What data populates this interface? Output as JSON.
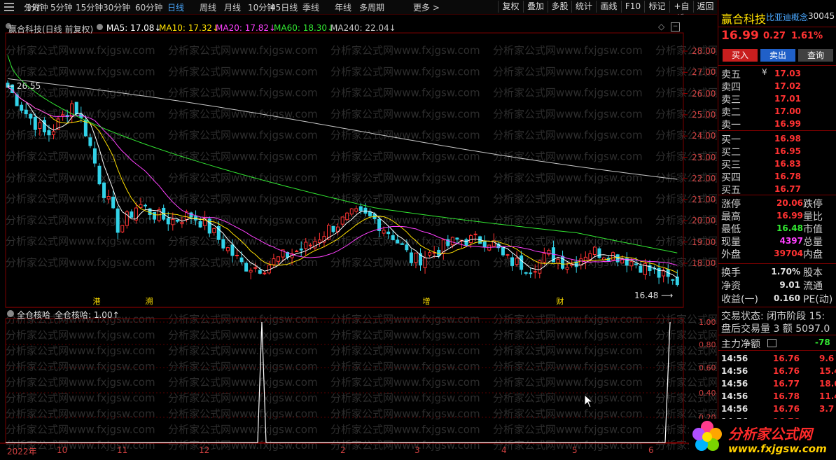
{
  "toolbar": {
    "periods": [
      "分时",
      "1分钟",
      "5分钟",
      "15分钟",
      "30分钟",
      "60分钟",
      "日线",
      "周线",
      "月线",
      "10分钟",
      "45日线",
      "季线",
      "年线",
      "多周期",
      "更多 >"
    ],
    "active_period": "日线",
    "buttons": [
      "复权",
      "叠加",
      "多股",
      "统计",
      "画线",
      "F10",
      "标记",
      "+自选",
      "返回"
    ]
  },
  "chart": {
    "stock_label": "赢合科技(日线 前复权)",
    "ma": [
      {
        "label": "MA5: 17.08↓",
        "color": "#ffffff"
      },
      {
        "label": "MA10: 17.32↓",
        "color": "#ffe000"
      },
      {
        "label": "MA20: 17.82↓",
        "color": "#ff40ff"
      },
      {
        "label": "MA60: 18.30↓",
        "color": "#32e832"
      },
      {
        "label": "MA240: 22.04↓",
        "color": "#c8c8c8"
      }
    ],
    "y_axis": [
      "28.00",
      "27.00",
      "26.00",
      "25.00",
      "24.00",
      "23.00",
      "22.00",
      "21.00",
      "20.00",
      "19.00",
      "18.00"
    ],
    "high_marker": "26.55",
    "low_marker": "16.48",
    "events": [
      "港",
      "溯",
      "增",
      "财"
    ],
    "watermark": "分析家公式网www.fxjgsw.com"
  },
  "indicator": {
    "name": "全仓核哈",
    "value_label": "全仓核哈: 1.00↑",
    "y_axis": [
      "1.00",
      "0.80",
      "0.60",
      "0.40",
      "0.20"
    ]
  },
  "x_axis": [
    "2022年",
    "10",
    "11",
    "12",
    "2",
    "3",
    "4",
    "5",
    "6"
  ],
  "quote": {
    "name": "赢合科技",
    "concept": "比亚迪概念",
    "code": "30045",
    "price": "16.99",
    "change": "0.27",
    "pct": "1.61%",
    "buy_btn": "买入",
    "sell_btn": "卖出",
    "query_btn": "查询",
    "asks": [
      {
        "label": "卖五",
        "price": "17.03"
      },
      {
        "label": "卖四",
        "price": "17.02"
      },
      {
        "label": "卖三",
        "price": "17.01"
      },
      {
        "label": "卖二",
        "price": "17.00"
      },
      {
        "label": "卖一",
        "price": "16.99"
      }
    ],
    "bids": [
      {
        "label": "买一",
        "price": "16.98"
      },
      {
        "label": "买二",
        "price": "16.95"
      },
      {
        "label": "买三",
        "price": "16.83"
      },
      {
        "label": "买四",
        "price": "16.78"
      },
      {
        "label": "买五",
        "price": "16.77"
      }
    ],
    "currency_mark": "¥",
    "stats": [
      {
        "l1": "涨停",
        "v1": "20.06",
        "c1": "red",
        "l2": "跌停"
      },
      {
        "l1": "最高",
        "v1": "16.99",
        "c1": "red",
        "l2": "量比"
      },
      {
        "l1": "最低",
        "v1": "16.48",
        "c1": "green",
        "l2": "市值"
      },
      {
        "l1": "现量",
        "v1": "4397",
        "c1": "purple",
        "l2": "总量"
      },
      {
        "l1": "外盘",
        "v1": "39704",
        "c1": "red",
        "l2": "内盘"
      }
    ],
    "stats2": [
      {
        "l1": "换手",
        "v1": "1.70%",
        "l2": "股本"
      },
      {
        "l1": "净资",
        "v1": "9.01",
        "l2": "流通"
      },
      {
        "l1": "收益(一)",
        "v1": "0.160",
        "l2": "PE(动)"
      }
    ],
    "trade_status": "交易状态: 闭市阶段 15:",
    "after_hours": "盘后交易量 3 额 5097.0",
    "main_flow_label": "主力净额",
    "main_flow_value": "-78",
    "ticks": [
      {
        "time": "14:56",
        "price": "16.76",
        "vol": "9.6",
        "c": "red"
      },
      {
        "time": "14:56",
        "price": "16.76",
        "vol": "15.4",
        "c": "red"
      },
      {
        "time": "14:56",
        "price": "16.77",
        "vol": "18.6",
        "c": "red"
      },
      {
        "time": "14:56",
        "price": "16.78",
        "vol": "11.4",
        "c": "red"
      },
      {
        "time": "14:56",
        "price": "16.76",
        "vol": "3.7",
        "c": "red"
      },
      {
        "time": "14:56",
        "price": "16.76",
        "vol": "",
        "c": "red"
      }
    ]
  },
  "logo": {
    "text": "分析家公式网",
    "url": "www.fxjgsw.com"
  }
}
